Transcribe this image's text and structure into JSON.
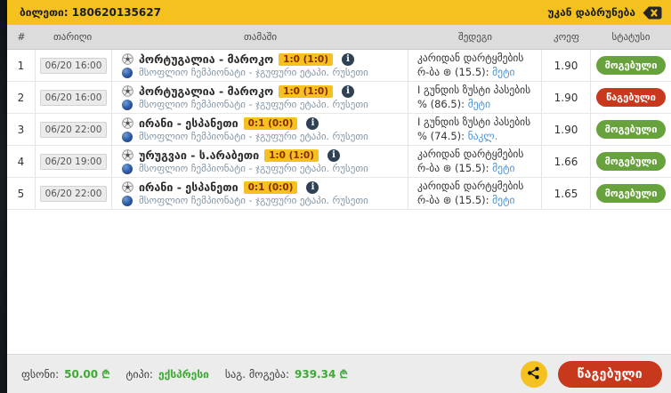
{
  "header": {
    "ticket_label": "ბილეთი: 180620135627",
    "back_label": "უკან დაბრუნება"
  },
  "table": {
    "columns": [
      "#",
      "თარიღი",
      "თამაში",
      "შედეგი",
      "კოეფ",
      "სტატუსი"
    ],
    "rows": [
      {
        "num": "1",
        "date": "06/20 16:00",
        "match": "პორტუგალია - მაროკო",
        "score": "1:0 (1:0)",
        "league": "მსოფლიო ჩემპიონატი - ჯგუფური ეტაპი. რუსეთი",
        "market": "კარიდან დარტყმების რ-ბა ⊛ (15.5):",
        "pick": "მეტი",
        "coef": "1.90",
        "status": "მოგებული",
        "status_type": "won"
      },
      {
        "num": "2",
        "date": "06/20 16:00",
        "match": "პორტუგალია - მაროკო",
        "score": "1:0 (1:0)",
        "league": "მსოფლიო ჩემპიონატი - ჯგუფური ეტაპი. რუსეთი",
        "market": "I გუნდის ზუსტი პასების % (86.5):",
        "pick": "მეტი",
        "coef": "1.90",
        "status": "წაგებული",
        "status_type": "lost"
      },
      {
        "num": "3",
        "date": "06/20 22:00",
        "match": "ირანი - ესპანეთი",
        "score": "0:1 (0:0)",
        "league": "მსოფლიო ჩემპიონატი - ჯგუფური ეტაპი. რუსეთი",
        "market": "I გუნდის ზუსტი პასების % (74.5):",
        "pick": "ნაკლ.",
        "coef": "1.90",
        "status": "მოგებული",
        "status_type": "won"
      },
      {
        "num": "4",
        "date": "06/20 19:00",
        "match": "ურუგვაი - ს.არაბეთი",
        "score": "1:0 (1:0)",
        "league": "მსოფლიო ჩემპიონატი - ჯგუფური ეტაპი. რუსეთი",
        "market": "კარიდან დარტყმების რ-ბა ⊛ (15.5):",
        "pick": "მეტი",
        "coef": "1.66",
        "status": "მოგებული",
        "status_type": "won"
      },
      {
        "num": "5",
        "date": "06/20 22:00",
        "match": "ირანი - ესპანეთი",
        "score": "0:1 (0:0)",
        "league": "მსოფლიო ჩემპიონატი - ჯგუფური ეტაპი. რუსეთი",
        "market": "კარიდან დარტყმების რ-ბა ⊛ (15.5):",
        "pick": "მეტი",
        "coef": "1.65",
        "status": "მოგებული",
        "status_type": "won"
      }
    ]
  },
  "footer": {
    "stake_label": "ფსონი:",
    "stake_value": "50.00 ₾",
    "type_label": "ტიპი:",
    "type_value": "ექსპრესი",
    "win_label": "საგ. მოგება:",
    "win_value": "939.34 ₾",
    "ticket_status_label": "წაგებული"
  },
  "colors": {
    "accent_yellow": "#f4c11e",
    "won_green": "#67a23c",
    "lost_red": "#c8381d",
    "money_green": "#3daa35",
    "pick_blue": "#4a90d9"
  }
}
